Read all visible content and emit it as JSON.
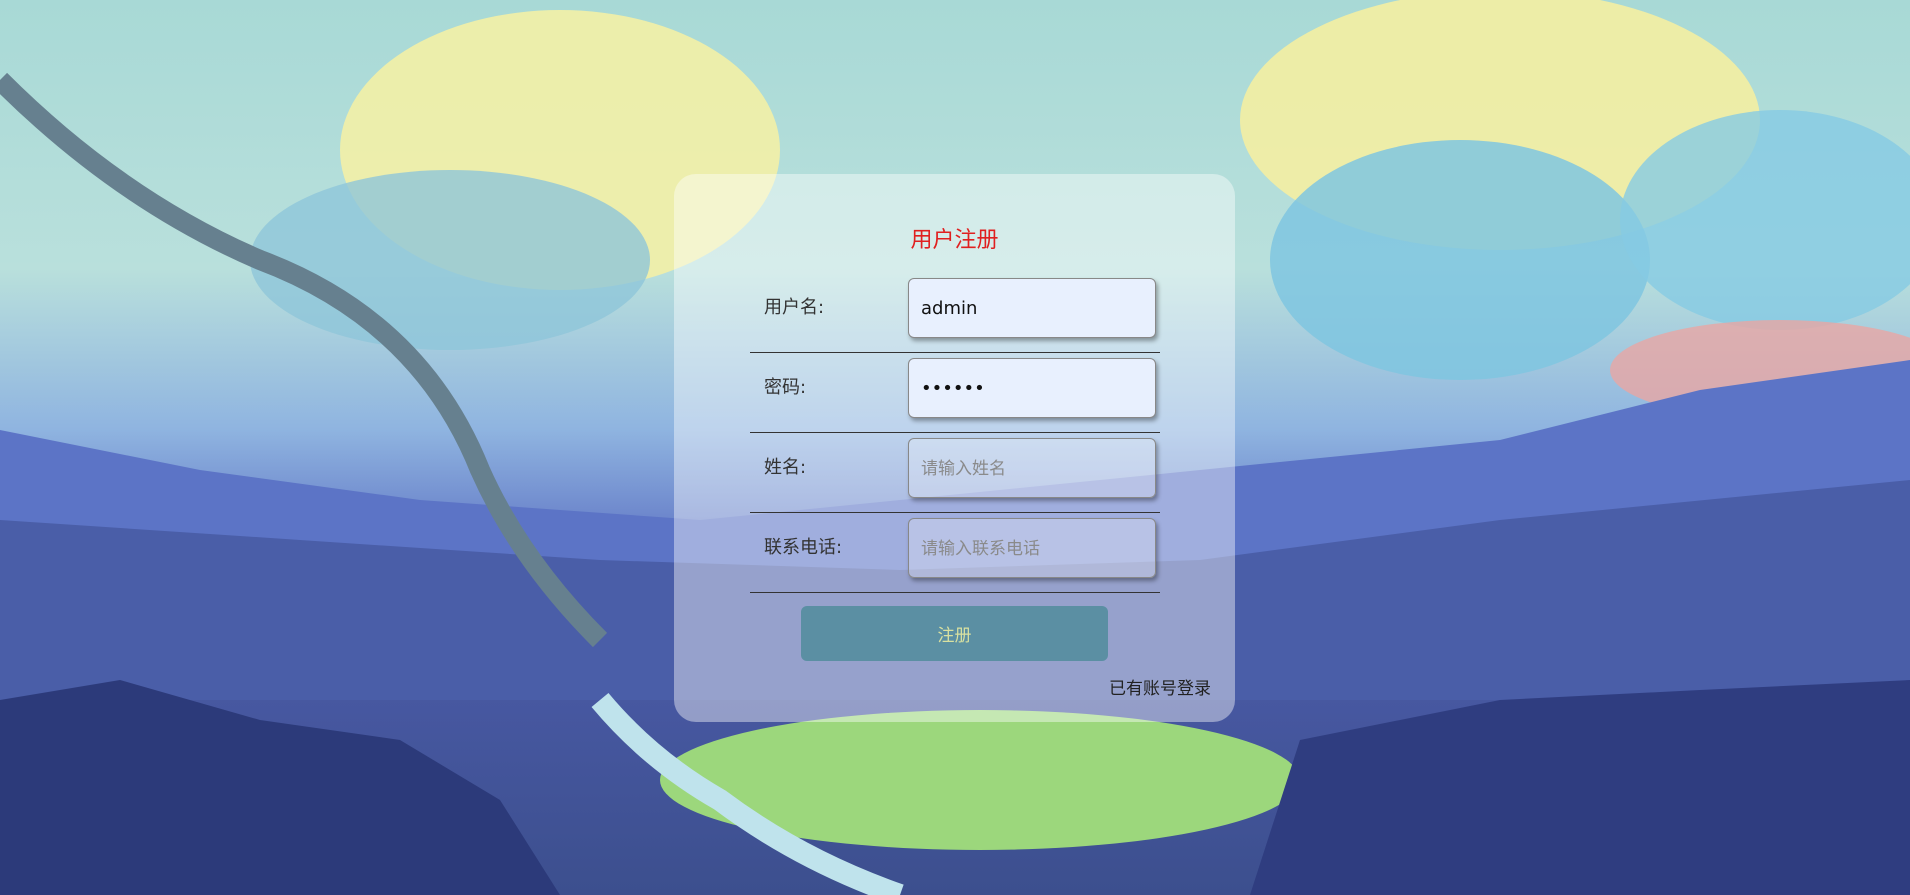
{
  "form": {
    "title": "用户注册",
    "fields": [
      {
        "label": "用户名:",
        "value": "admin",
        "placeholder": ""
      },
      {
        "label": "密码:",
        "value": "••••••",
        "placeholder": ""
      },
      {
        "label": "姓名:",
        "value": "",
        "placeholder": "请输入姓名"
      },
      {
        "label": "联系电话:",
        "value": "",
        "placeholder": "请输入联系电话"
      }
    ],
    "submit_label": "注册",
    "login_link": "已有账号登录"
  },
  "colors": {
    "title": "#e02020",
    "submit_bg": "#5b8fa3",
    "submit_text": "#d9e1a0"
  }
}
